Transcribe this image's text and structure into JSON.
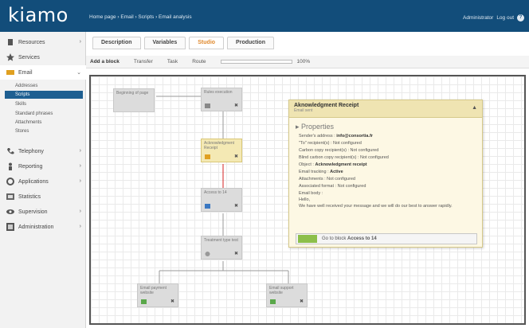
{
  "header": {
    "logo": "kiamo",
    "breadcrumb": "Home page › Email › Scripts › Email analysis",
    "user": "Administrator",
    "logout": "Log out",
    "help": "?"
  },
  "sidebar": {
    "items": [
      {
        "label": "Resources",
        "icon": "resources-icon"
      },
      {
        "label": "Services",
        "icon": "star-icon"
      },
      {
        "label": "Email",
        "icon": "email-icon"
      },
      {
        "label": "Telephony",
        "icon": "phone-icon"
      },
      {
        "label": "Reporting",
        "icon": "person-icon"
      },
      {
        "label": "Applications",
        "icon": "gear-icon"
      },
      {
        "label": "Statistics",
        "icon": "chart-icon"
      },
      {
        "label": "Supervision",
        "icon": "eye-icon"
      },
      {
        "label": "Administration",
        "icon": "admin-icon"
      }
    ],
    "email_subitems": [
      "Addresses",
      "Scripts",
      "Skills",
      "Standard phrases",
      "Attachments",
      "Stores"
    ]
  },
  "tabs": [
    "Description",
    "Variables",
    "Studio",
    "Production"
  ],
  "active_tab": "Studio",
  "toolbar": {
    "add_block": "Add a block",
    "transfer": "Transfer",
    "task": "Task",
    "route": "Route",
    "zoom": "100%"
  },
  "blocks": [
    {
      "label": "Beginning of page"
    },
    {
      "label": "Rules execution"
    },
    {
      "label": "Acknowledgment Receipt"
    },
    {
      "label": "Access to 14"
    },
    {
      "label": "Treatment type test"
    },
    {
      "label": "Email payment website"
    },
    {
      "label": "Email support website"
    }
  ],
  "popup": {
    "title": "Aknowledgment Receipt",
    "subtitle": "Email sent",
    "properties_title": "Properties",
    "properties": [
      {
        "label": "Sender's address :",
        "value": "info@consortia.fr"
      },
      {
        "label": "\"To\" recipient(s) :",
        "value": "Not configured"
      },
      {
        "label": "Carbon copy recipient(s) :",
        "value": "Not configured"
      },
      {
        "label": "Blind carbon copy recipient(s) :",
        "value": "Not configured"
      },
      {
        "label": "Object :",
        "value": "Acknowledgment receipt"
      },
      {
        "label": "Email tracking :",
        "value": "Active"
      },
      {
        "label": "Attachments :",
        "value": "Not configured"
      },
      {
        "label": "Associated format :",
        "value": "Not configured"
      },
      {
        "label": "Email body :",
        "value": ""
      },
      {
        "label": "Hello,",
        "value": ""
      },
      {
        "label": "We have well received your message and we will do our best to answer rapidly.",
        "value": ""
      }
    ],
    "goto_prefix": "Go to block",
    "goto_target": "Access to 14"
  },
  "colors": {
    "header": "#124d7a",
    "active_subitem": "#1e5f91",
    "tab_active": "#e08a2e",
    "popup_bg": "#fdf8e4",
    "selected_block": "#f4e9b4",
    "link_line": "#d42020"
  }
}
